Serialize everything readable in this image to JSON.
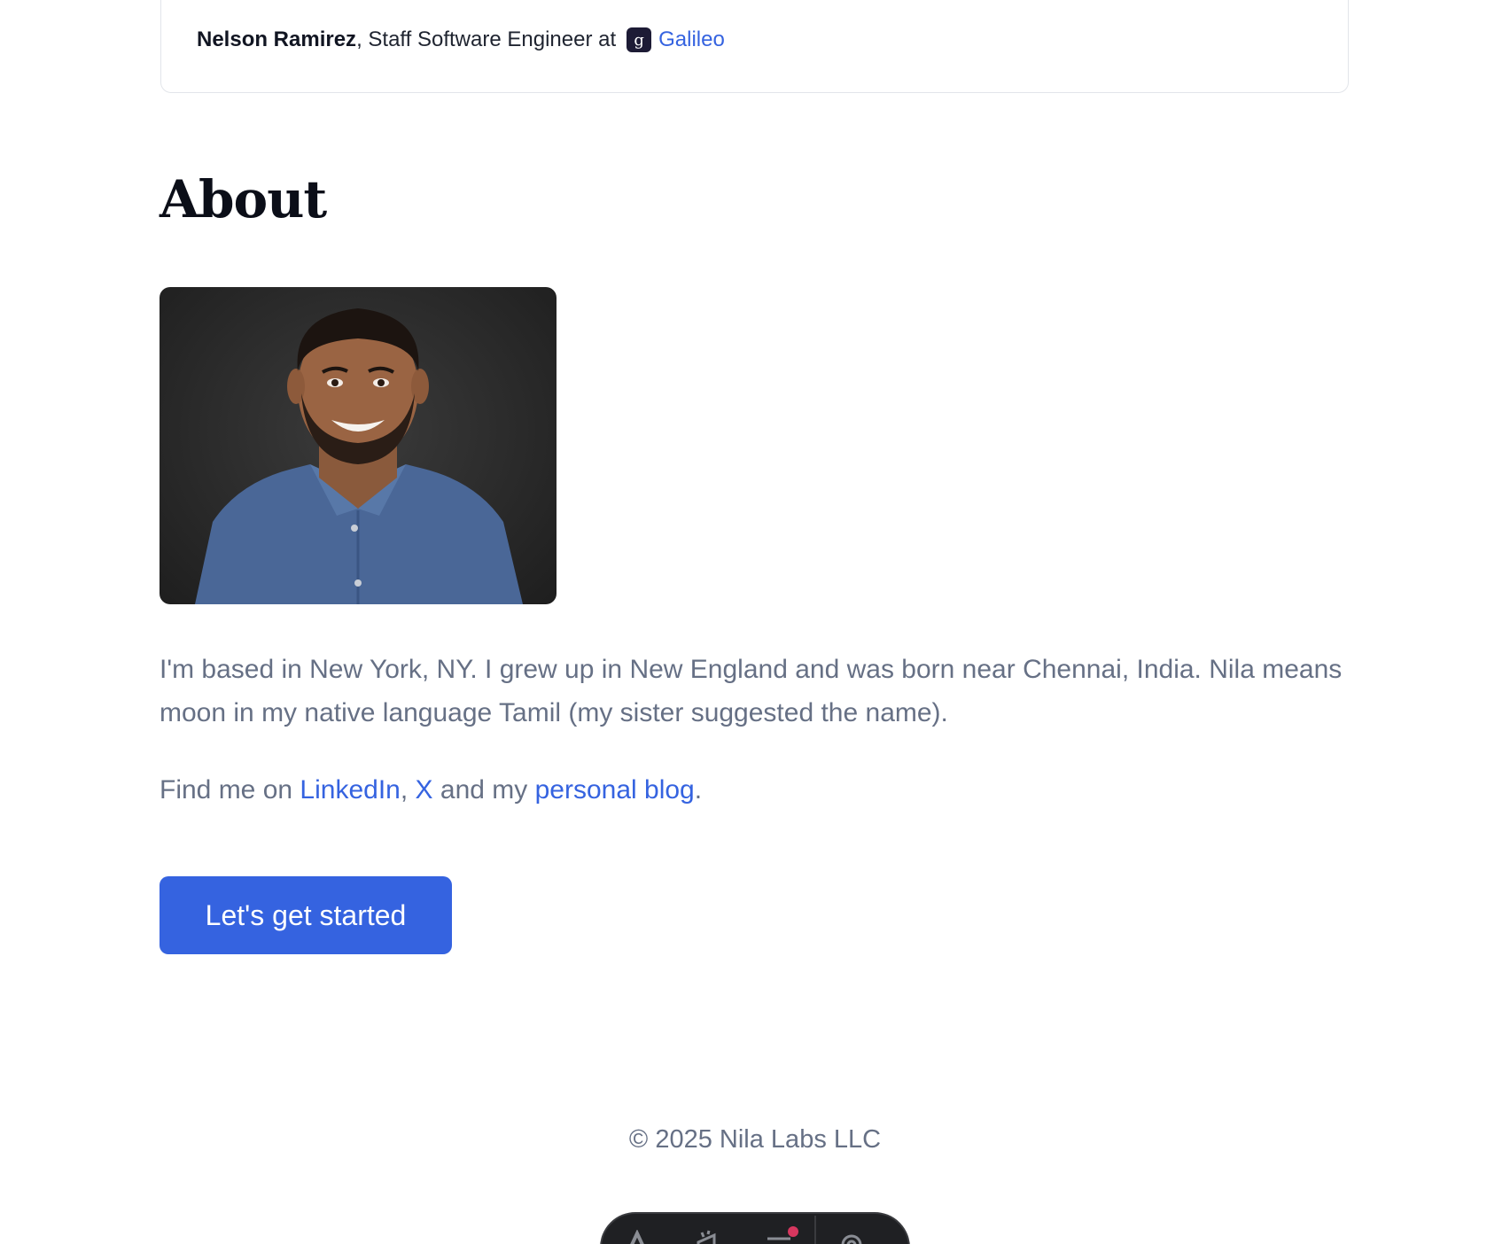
{
  "testimonial": {
    "author_name": "Nelson Ramirez",
    "author_role": ", Staff Software Engineer at",
    "company_logo_letter": "g",
    "company_name": "Galileo"
  },
  "about": {
    "title": "About",
    "bio": "I'm based in New York, NY. I grew up in New England and was born near Chennai, India. Nila means moon in my native language Tamil (my sister suggested the name).",
    "links_prefix": "Find me on ",
    "linkedin_label": "LinkedIn",
    "sep_comma": ", ",
    "x_label": "X",
    "and_my": " and my ",
    "blog_label": "personal blog",
    "period": "."
  },
  "cta": {
    "label": "Let's get started"
  },
  "footer": {
    "copyright": "© 2025 Nila Labs LLC"
  },
  "toolbar": {
    "icons": [
      "text-icon",
      "megaphone-icon",
      "menu-notification-icon",
      "gear-icon"
    ]
  },
  "colors": {
    "accent": "#3563e0",
    "muted_text": "#667085",
    "heading": "#0b0e18",
    "toolbar_bg": "#1f2023",
    "notification": "#d7375f"
  }
}
